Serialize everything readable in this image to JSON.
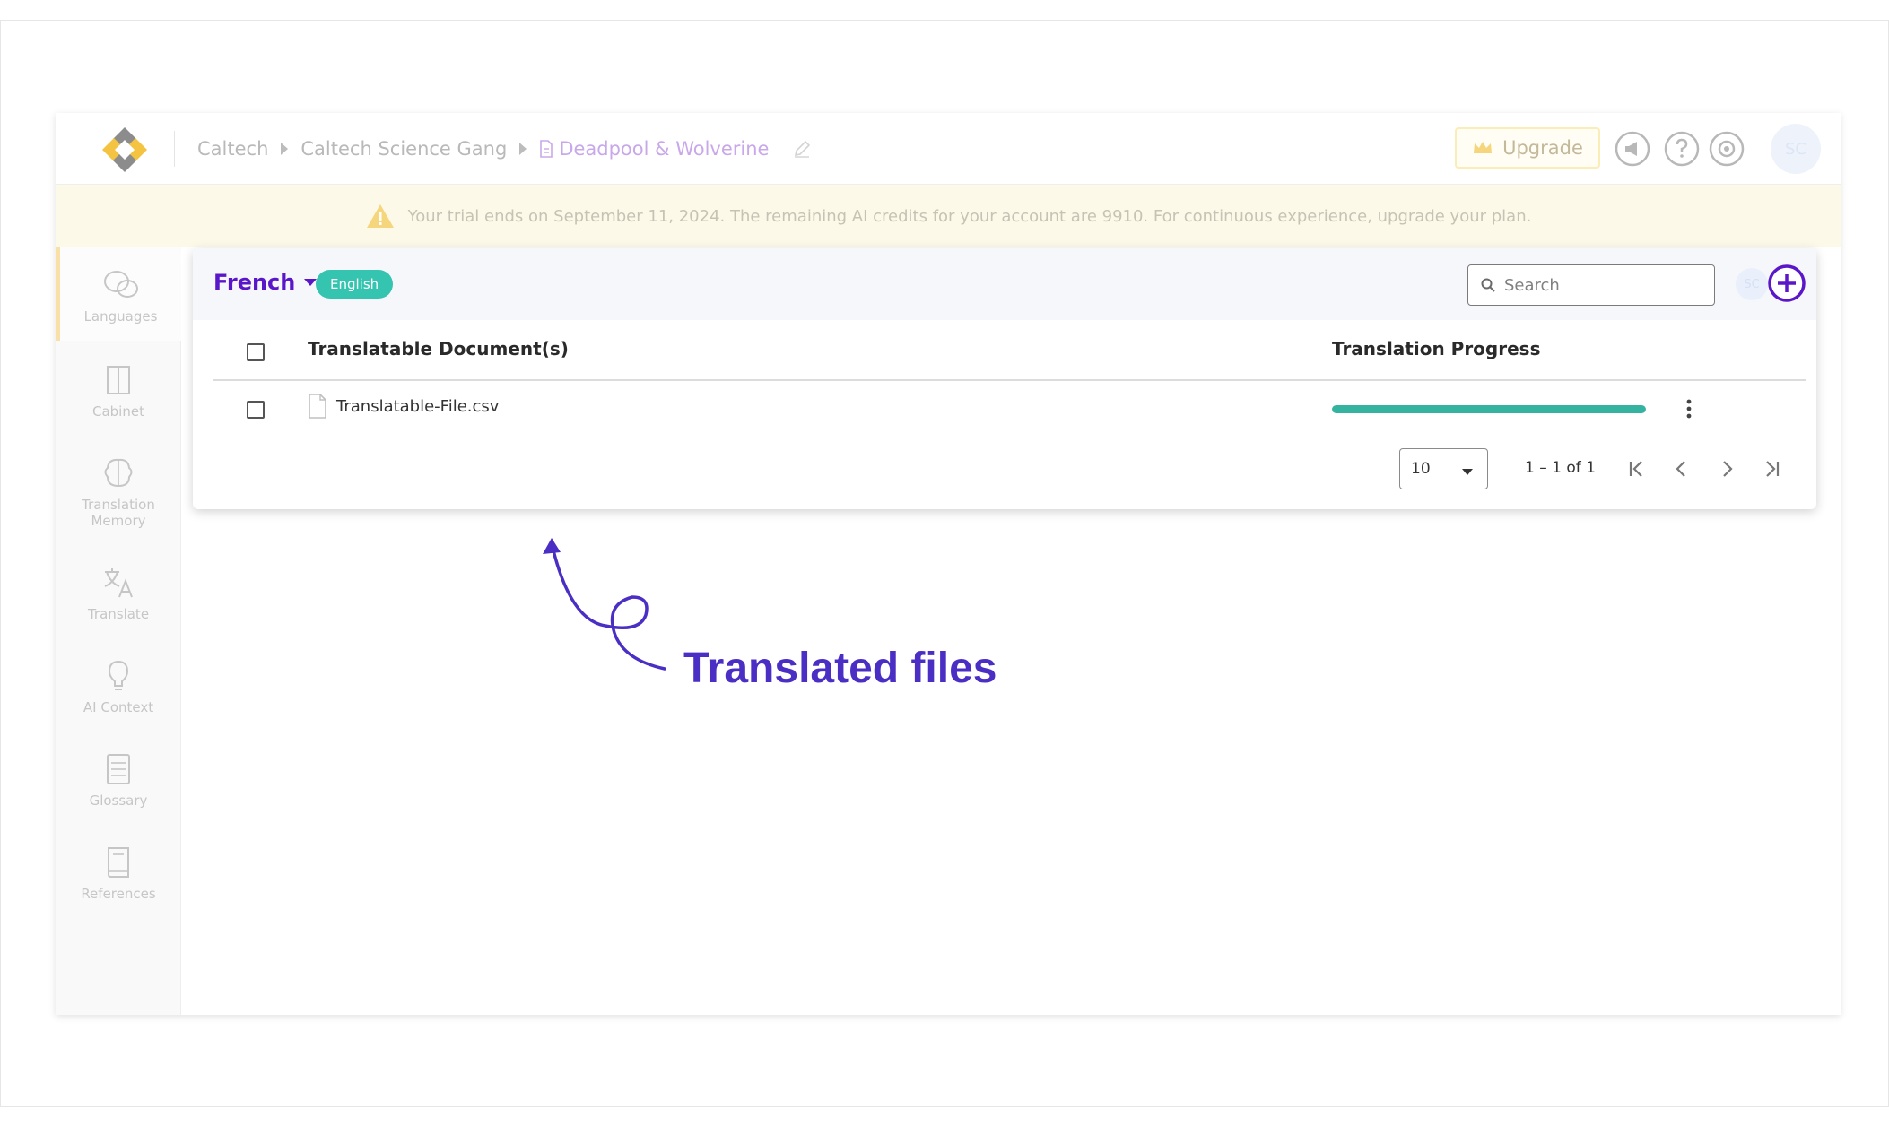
{
  "breadcrumb": {
    "org": "Caltech",
    "team": "Caltech Science Gang",
    "project": "Deadpool & Wolverine"
  },
  "header": {
    "upgrade_label": "Upgrade",
    "avatar_initials": "SC"
  },
  "banner": {
    "message": "Your trial ends on September 11, 2024. The remaining AI credits for your account are 9910. For continuous experience, upgrade your plan."
  },
  "sidebar": {
    "items": [
      {
        "label": "Languages"
      },
      {
        "label": "Cabinet"
      },
      {
        "label": "Translation Memory"
      },
      {
        "label": "Translate"
      },
      {
        "label": "AI Context"
      },
      {
        "label": "Glossary"
      },
      {
        "label": "References"
      }
    ]
  },
  "panel": {
    "target_language": "French",
    "source_language": "English",
    "search_placeholder": "Search",
    "mini_avatar_initials": "SC"
  },
  "table": {
    "columns": [
      "Translatable Document(s)",
      "Translation Progress"
    ],
    "rows": [
      {
        "file_name": "Translatable-File.csv",
        "progress": 1.0
      }
    ]
  },
  "pager": {
    "page_size": "10",
    "range": "1 – 1 of 1"
  },
  "annotation": {
    "text": "Translated files",
    "color": "#4b2fc4"
  },
  "colors": {
    "accent": "#5a17c9",
    "badge": "#35c4b0",
    "progress": "#34b3a0",
    "banner_bg": "#fdf9e9"
  }
}
